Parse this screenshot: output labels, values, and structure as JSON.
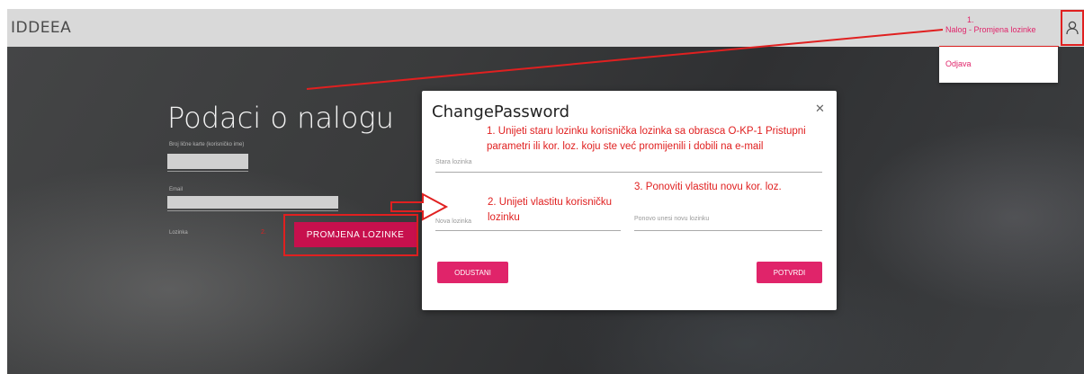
{
  "header": {
    "brand": "IDDEEA",
    "nav_step_number": "1.",
    "nav_link": "Nalog - Promjena lozinke",
    "user_icon": "user-icon"
  },
  "dropdown": {
    "items": [
      {
        "label": "Odjava"
      }
    ]
  },
  "account": {
    "title": "Podaci o nalogu",
    "id_label": "Broj lične karte (korisničko ime)",
    "email_label": "Email",
    "password_label": "Lozinka",
    "change_password_button": "PROMJENA LOZINKE",
    "step_number": "2."
  },
  "modal": {
    "title": "ChangePassword",
    "close_icon": "close-icon",
    "old_password_label": "Stara lozinka",
    "new_password_label": "Nova lozinka",
    "repeat_password_placeholder": "Ponovo unesi novu lozinku",
    "cancel_button": "ODUSTANI",
    "confirm_button": "POTVRDI"
  },
  "annotations": {
    "step1": "1. Unijeti staru lozinku korisnička lozinka sa obrasca O-KP-1 Pristupni parametri ili kor. loz. koju ste već promijenili i dobili na e-mail",
    "step2": "2. Unijeti vlastitu korisničku lozinku",
    "step3": "3. Ponoviti vlastitu novu kor. loz."
  },
  "colors": {
    "accent": "#e0246a",
    "annotation_red": "#e02020",
    "topbar": "#d9d9d9"
  }
}
